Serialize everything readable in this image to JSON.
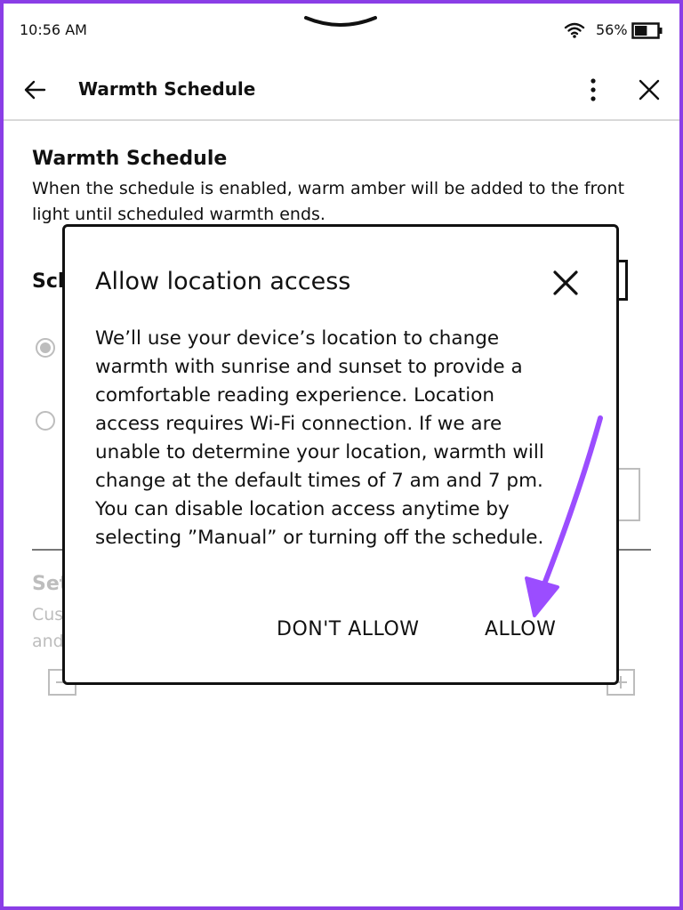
{
  "status_bar": {
    "time": "10:56 AM",
    "battery_percent": "56%",
    "battery_level": 0.56,
    "icons": [
      "pull-down-handle-icon",
      "wifi-icon",
      "battery-icon"
    ]
  },
  "header": {
    "title": "Warmth Schedule",
    "icons": [
      "back-arrow-icon",
      "more-options-icon",
      "close-icon"
    ]
  },
  "page": {
    "section_title": "Warmth Schedule",
    "section_desc": "When the schedule is enabled, warm amber will be added to the front light until scheduled warmth ends.",
    "schedule_label": "Sch",
    "set_label": "Set",
    "set_desc_line1": "Cus",
    "set_desc_line2": "and",
    "minus_label": "−",
    "plus_label": "+"
  },
  "dialog": {
    "title": "Allow location access",
    "body_lines": [
      "We’ll use your device’s location to change",
      "warmth with sunrise and sunset to provide a",
      "comfortable reading experience. Location",
      "access requires Wi-Fi connection. If we are",
      "unable to determine your location, warmth will",
      "change at the default times of 7 am and 7 pm.",
      "You can disable location access anytime by",
      "selecting ”Manual” or turning off the schedule."
    ],
    "dont_allow_label": "DON'T ALLOW",
    "allow_label": "ALLOW"
  },
  "colors": {
    "frame": "#8a3ee6",
    "annotation_arrow": "#9b4dff",
    "text": "#111111",
    "disabled": "#bdbdbd"
  }
}
